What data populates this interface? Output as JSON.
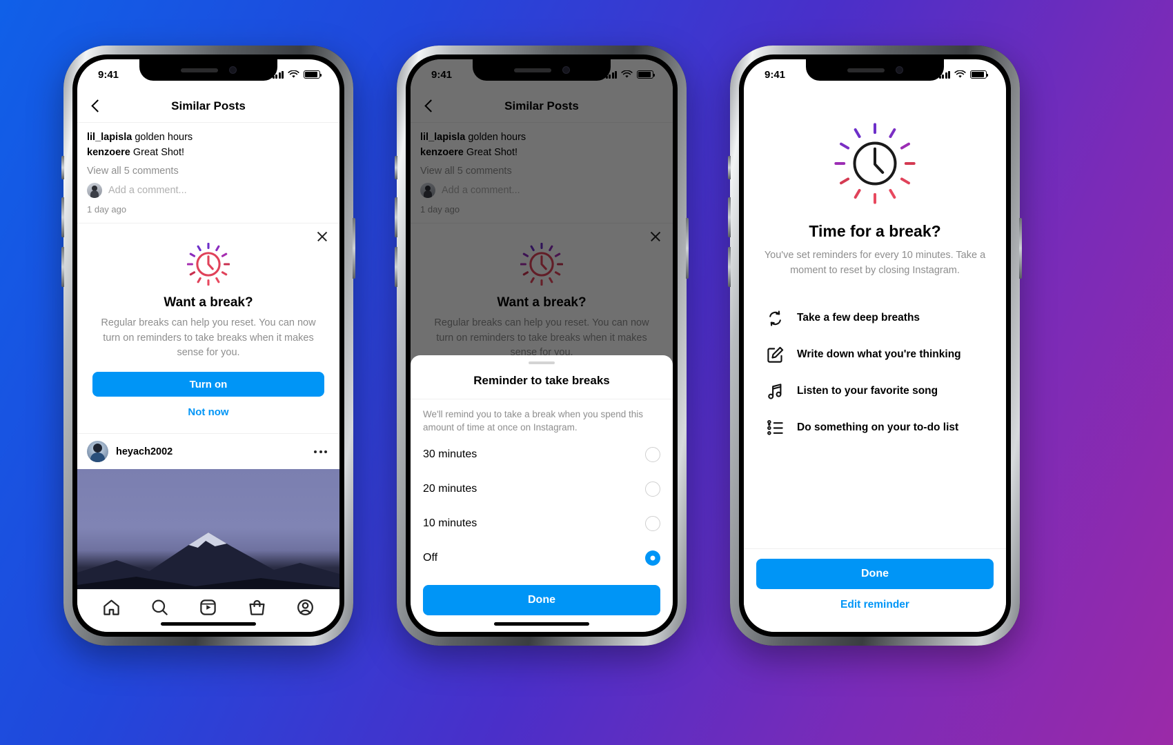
{
  "colors": {
    "accent": "#0095f6",
    "muted": "#8e8e8e",
    "bg_gradient_start": "#1060e8",
    "bg_gradient_end": "#9b2aa8",
    "dash_top": "#7b2fc4",
    "dash_bottom": "#e8495f"
  },
  "phones": [
    {
      "id": "phone-1",
      "status": {
        "time": "9:41"
      },
      "header": {
        "title": "Similar Posts",
        "back_icon": "chevron-left-icon"
      },
      "post_caption": {
        "line1_user": "lil_lapisla",
        "line1_text": "golden hours",
        "line2_user": "kenzoere",
        "line2_text": "Great Shot!",
        "view_all": "View all 5 comments",
        "add_comment_placeholder": "Add a comment...",
        "time_ago": "1 day ago"
      },
      "break_card": {
        "close_icon": "close-icon",
        "icon": "clock-rays-icon",
        "title": "Want a break?",
        "body": "Regular breaks can help you reset. You can now turn on reminders to take breaks when it makes sense for you.",
        "primary_label": "Turn on",
        "secondary_label": "Not now"
      },
      "next_post": {
        "username": "heyach2002",
        "more_icon": "more-horizontal-icon",
        "image_alt": "mountain-photo"
      },
      "tabbar": [
        {
          "name": "home-icon",
          "label": "Home"
        },
        {
          "name": "search-icon",
          "label": "Search"
        },
        {
          "name": "reels-icon",
          "label": "Reels"
        },
        {
          "name": "shop-icon",
          "label": "Shop"
        },
        {
          "name": "profile-icon",
          "label": "Profile"
        }
      ]
    },
    {
      "id": "phone-2",
      "status": {
        "time": "9:41"
      },
      "header": {
        "title": "Similar Posts",
        "back_icon": "chevron-left-icon"
      },
      "post_caption": {
        "line1_user": "lil_lapisla",
        "line1_text": "golden hours",
        "line2_user": "kenzoere",
        "line2_text": "Great Shot!",
        "view_all": "View all 5 comments",
        "add_comment_placeholder": "Add a comment...",
        "time_ago": "1 day ago"
      },
      "break_card": {
        "close_icon": "close-icon",
        "icon": "clock-rays-icon",
        "title": "Want a break?",
        "body": "Regular breaks can help you reset. You can now turn on reminders to take breaks when it makes sense for you."
      },
      "sheet": {
        "title": "Reminder to take breaks",
        "subtitle": "We'll remind you to take a break when you spend this amount of time at once on Instagram.",
        "options": [
          {
            "label": "30 minutes",
            "selected": false
          },
          {
            "label": "20 minutes",
            "selected": false
          },
          {
            "label": "10 minutes",
            "selected": false
          },
          {
            "label": "Off",
            "selected": true
          }
        ],
        "done_label": "Done"
      }
    },
    {
      "id": "phone-3",
      "status": {
        "time": "9:41"
      },
      "icon": "clock-rays-icon",
      "title": "Time for a break?",
      "subtitle": "You've set reminders for every 10 minutes. Take a moment to reset by closing Instagram.",
      "suggestions": [
        {
          "icon": "refresh-loop-icon",
          "label": "Take a few deep breaths"
        },
        {
          "icon": "edit-square-icon",
          "label": "Write down what you're thinking"
        },
        {
          "icon": "music-note-icon",
          "label": "Listen to your favorite song"
        },
        {
          "icon": "todo-list-icon",
          "label": "Do something on your to-do list"
        }
      ],
      "done_label": "Done",
      "edit_label": "Edit reminder"
    }
  ]
}
